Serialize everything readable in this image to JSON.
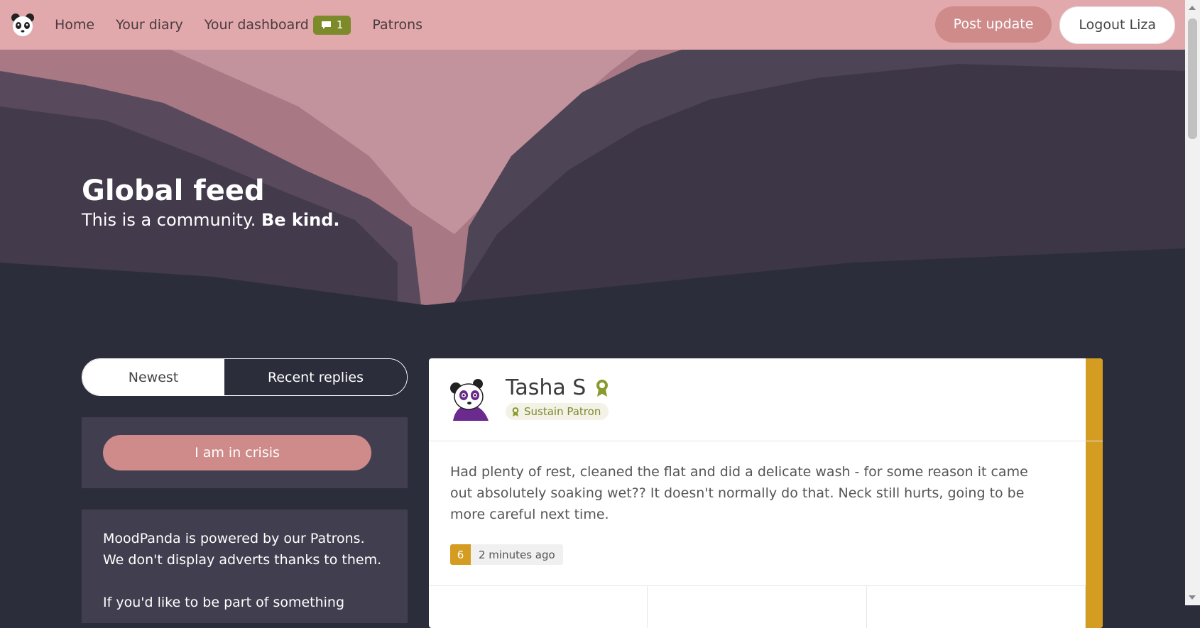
{
  "nav": {
    "links": [
      "Home",
      "Your diary",
      "Your dashboard",
      "Patrons"
    ],
    "dashboard_badge_count": "1",
    "post_update_label": "Post update",
    "logout_label": "Logout Liza"
  },
  "hero": {
    "title": "Global feed",
    "subtitle_plain": "This is a community.",
    "subtitle_bold": "Be kind."
  },
  "tabs": {
    "newest": "Newest",
    "recent_replies": "Recent replies",
    "active": "Recent replies"
  },
  "crisis_button": "I am in crisis",
  "patrons_panel": {
    "line1": "MoodPanda is powered by our Patrons.",
    "line2": "We don't display adverts thanks to them.",
    "line3": "If you'd like to be part of something"
  },
  "post": {
    "author": "Tasha S",
    "patron_tag": "Sustain Patron",
    "text": "Had plenty of rest, cleaned the flat and did a delicate wash - for some reason it came out absolutely soaking wet?? It doesn't normally do that. Neck still hurts, going to be more careful next time.",
    "mood": "6",
    "time": "2 minutes ago"
  },
  "colors": {
    "navbar": "#e2a9ad",
    "accent_pink": "#cf8a8a",
    "badge_green": "#7d8a2a",
    "mood_gold": "#d49c21",
    "background": "#2c2d3b",
    "panel": "#413f4f"
  },
  "icons": {
    "logo": "panda-logo-icon",
    "dashboard_badge": "comment-icon",
    "patron": "award-ribbon-icon"
  }
}
